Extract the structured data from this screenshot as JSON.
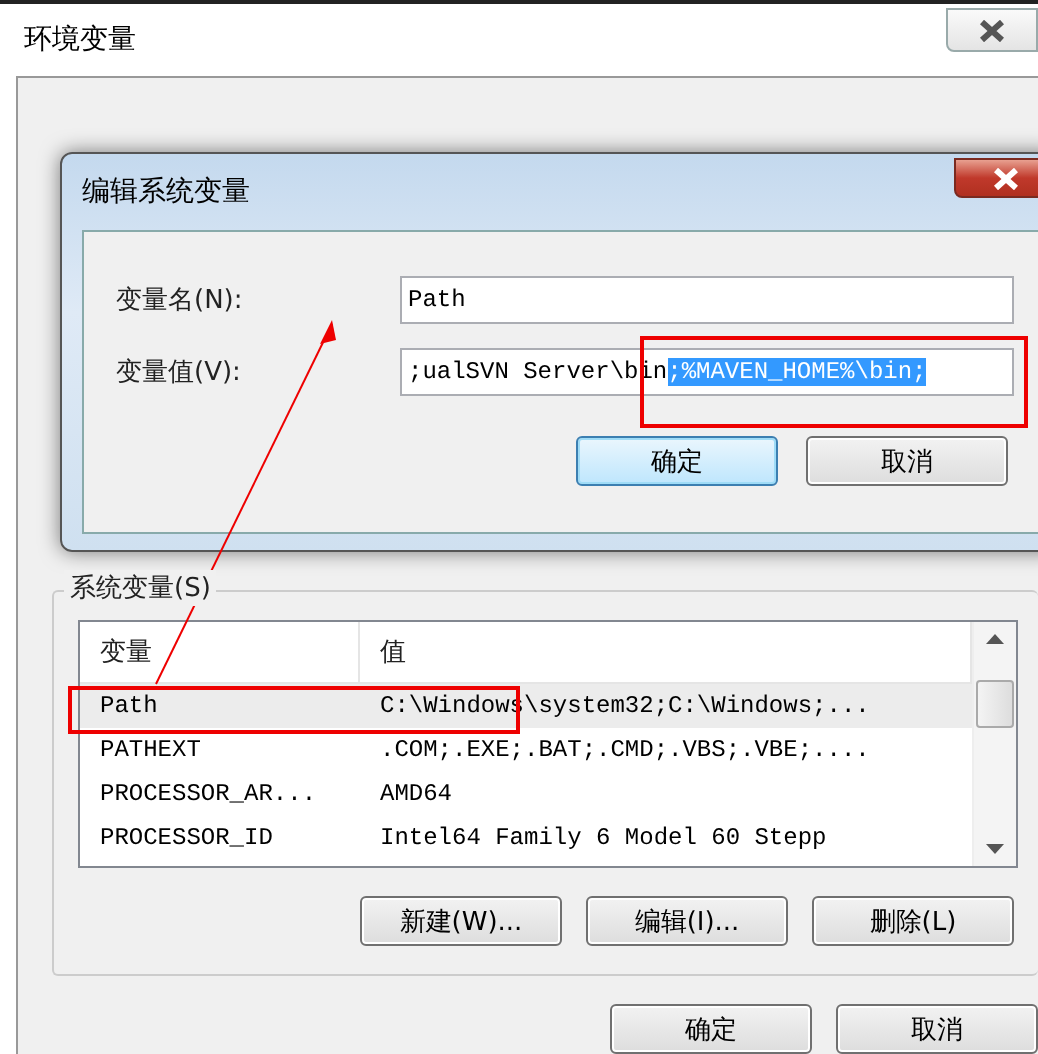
{
  "window": {
    "title": "环境变量"
  },
  "dialog": {
    "title": "编辑系统变量",
    "name_label": "变量名(N):",
    "name_value": "Path",
    "value_label": "变量值(V):",
    "value_text": ";ualSVN Server\\bin",
    "value_selected": ";%MAVEN_HOME%\\bin;",
    "buttons": [
      {
        "label": "确定",
        "default": true
      },
      {
        "label": "取消",
        "default": false
      }
    ]
  },
  "system_variables": {
    "title": "系统变量(S)",
    "columns": [
      "变量",
      "值"
    ],
    "rows": [
      {
        "name": "Path",
        "value": "C:\\Windows\\system32;C:\\Windows;...",
        "selected": true
      },
      {
        "name": "PATHEXT",
        "value": ".COM;.EXE;.BAT;.CMD;.VBS;.VBE;....",
        "selected": false
      },
      {
        "name": "PROCESSOR_AR...",
        "value": "AMD64",
        "selected": false
      },
      {
        "name": "PROCESSOR_ID",
        "value": "Intel64 Family 6 Model 60 Stepp",
        "selected": false
      }
    ],
    "buttons": [
      "新建(W)...",
      "编辑(I)...",
      "删除(L)"
    ]
  },
  "footer_buttons": [
    "确定",
    "取消"
  ]
}
